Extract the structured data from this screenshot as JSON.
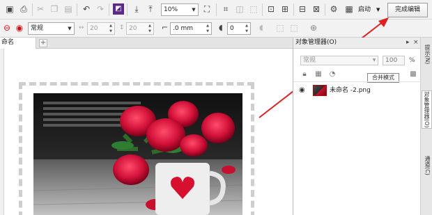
{
  "toolbar": {
    "zoom_value": "10%",
    "launch_label": "启动",
    "finish_label": "完成编辑"
  },
  "property_bar": {
    "mode_value": "常规",
    "field_a_value": "20",
    "field_b_value": "20",
    "corner_value": ".0 mm",
    "opacity_value": "0"
  },
  "document": {
    "tab_label": "命名 -2.png"
  },
  "object_manager": {
    "title": "对象管理器(O)",
    "blend_mode_value": "常规",
    "opacity_value": "100",
    "percent_sign": "%",
    "tooltip_text": "合并模式",
    "layers": [
      {
        "name": "未命名 -2.png"
      }
    ]
  },
  "side_tabs": {
    "hints": "提示(N)",
    "object_manager": "对象管理器(O)",
    "channels": "通道(C)"
  },
  "colors": {
    "accent_arrow": "#e02020",
    "finish_button_border": "#9a9a9a"
  }
}
